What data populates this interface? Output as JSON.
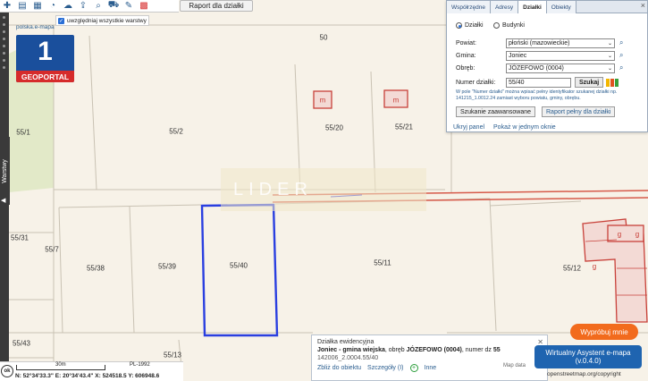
{
  "toolbar": {
    "icons": [
      "add-icon",
      "layers-icon",
      "grid-icon",
      "comment-icon",
      "cloud-icon",
      "cloud-upload-icon",
      "search-zoom-icon",
      "cart-icon",
      "tools-icon",
      "palette-icon"
    ],
    "report_button": "Raport dla działki",
    "layers_checkbox_label": "uwzględniaj wszystkie warstwy"
  },
  "sidebar": {
    "warstwy_tab": "Warstwy"
  },
  "logo": {
    "number": "1",
    "text": "GEOPORTAL"
  },
  "map": {
    "source_label": "polska.e-mapa",
    "watermark": "LIDER",
    "parcel_labels": [
      "50",
      "55/20",
      "55/21",
      "55/1",
      "55/2",
      "55/31",
      "55/7",
      "55/38",
      "55/39",
      "55/40",
      "55/11",
      "55/12",
      "55/43",
      "55/13"
    ],
    "building_labels": [
      "m",
      "m",
      "g",
      "g",
      "g"
    ]
  },
  "search_panel": {
    "tabs": [
      "Współrzędne",
      "Adresy",
      "Działki",
      "Obiekty"
    ],
    "active_tab": "Działki",
    "radio_dzialki": "Działki",
    "radio_budynki": "Budynki",
    "powiat_label": "Powiat:",
    "powiat_value": "płoński (mazowieckie)",
    "gmina_label": "Gmina:",
    "gmina_value": "Joniec",
    "obreb_label": "Obręb:",
    "obreb_value": "JÓZEFOWO (0004)",
    "numer_label": "Numer działki:",
    "numer_value": "55/40",
    "search_button": "Szukaj",
    "hint": "W pole \"Numer działki\" można wpisać pełny identyfikator szukanej działki np. 141215_1.0012.24 zamiast wyboru powiatu, gminy, obrębu.",
    "advanced_button": "Szukanie zaawansowane",
    "full_report_button": "Raport pełny dla działki",
    "link_hide": "Ukryj panel",
    "link_show_all": "Pokaż w jednym oknie",
    "close": "×"
  },
  "info_box": {
    "title": "Działka ewidencyjna",
    "municipality": "Joniec - gmina wiejska",
    "obreb_text": ", obręb ",
    "obreb_name": "JÓZEFOWO (0004)",
    "numer_text": ", numer dz ",
    "numer_value": "55",
    "identifier": "142006_2.0004.55/40",
    "link_zoom": "Zbliż do obiektu",
    "link_details": "Szczegóły (I)",
    "link_other": "Inne"
  },
  "assistant": {
    "try_button": "Wypróbuj mnie",
    "title": "Wirtualny Asystent e-mapa",
    "version": "(v.0.4.0)"
  },
  "status_bar": {
    "ok_label": "ok",
    "scale_label": "30m",
    "crs_label": "PL-1992",
    "coordinates": "N: 52°34'33.3\"   E: 20°34'43.4\"   X: 524518.5   Y: 606948.6"
  },
  "attribution": {
    "map_label": "Map data",
    "osm": "openstreetmap.org/copyright"
  },
  "colors": {
    "selected_parcel": "#2a3fe0",
    "building_outline": "#c8413a",
    "logo_blue": "#1a4f9c",
    "logo_red": "#d62b2b",
    "assistant_blue": "#1f64b0",
    "try_orange": "#f26b1d"
  }
}
